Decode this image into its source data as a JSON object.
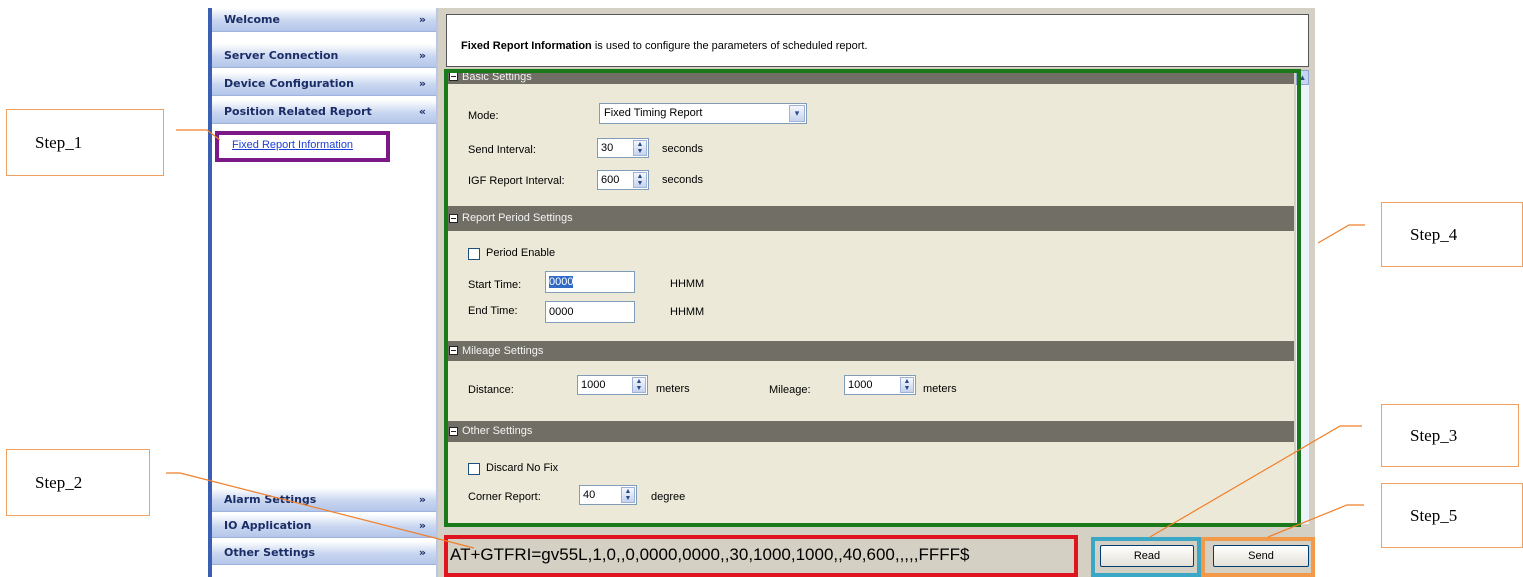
{
  "nav": {
    "items": [
      {
        "label": "Welcome",
        "chevron": "»"
      },
      {
        "label": "Server Connection",
        "chevron": "»"
      },
      {
        "label": "Device Configuration",
        "chevron": "»"
      },
      {
        "label": "Position Related Report",
        "chevron": "«"
      },
      {
        "label": "Alarm Settings",
        "chevron": "»"
      },
      {
        "label": "IO Application",
        "chevron": "»"
      },
      {
        "label": "Other Settings",
        "chevron": "»"
      }
    ],
    "sub_link": "Fixed Report Information"
  },
  "info": {
    "title": "Fixed Report Information",
    "text": " is used to configure the parameters of scheduled report."
  },
  "basic": {
    "header": "Basic Settings",
    "mode_label": "Mode:",
    "mode_value": "Fixed Timing Report",
    "send_interval_label": "Send Interval:",
    "send_interval_value": "30",
    "send_interval_unit": "seconds",
    "igf_label": "IGF Report Interval:",
    "igf_value": "600",
    "igf_unit": "seconds"
  },
  "period": {
    "header": "Report Period Settings",
    "enable_label": "Period Enable",
    "start_label": "Start Time:",
    "start_value": "0000",
    "start_unit": "HHMM",
    "end_label": "End Time:",
    "end_value": "0000",
    "end_unit": "HHMM"
  },
  "mileage": {
    "header": "Mileage Settings",
    "distance_label": "Distance:",
    "distance_value": "1000",
    "distance_unit": "meters",
    "mileage_label": "Mileage:",
    "mileage_value": "1000",
    "mileage_unit": "meters"
  },
  "other": {
    "header": "Other Settings",
    "discard_label": "Discard No Fix",
    "corner_label": "Corner Report:",
    "corner_value": "40",
    "corner_unit": "degree"
  },
  "command": {
    "text": "AT+GTFRI=gv55L,1,0,,0,0000,0000,,30,1000,1000,,40,600,,,,,FFFF$"
  },
  "buttons": {
    "read": "Read",
    "send": "Send"
  },
  "steps": {
    "s1": "Step_1",
    "s2": "Step_2",
    "s3": "Step_3",
    "s4": "Step_4",
    "s5": "Step_5"
  },
  "colors": {
    "step_border": "#f0a060",
    "purple": "#7b1a86",
    "green": "#1a7a1a",
    "red": "#e0141e",
    "cyan": "#3aa7c6",
    "orange": "#f29a4a"
  }
}
